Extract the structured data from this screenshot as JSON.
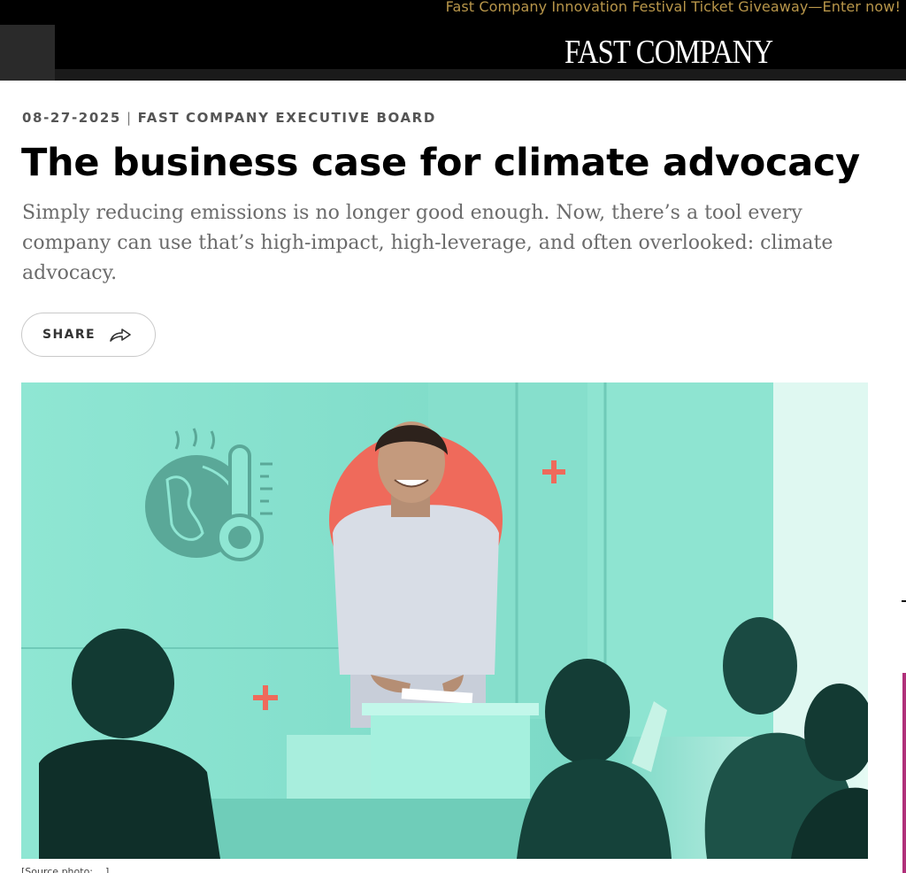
{
  "promo": {
    "text": "Fast Company Innovation Festival Ticket Giveaway—Enter now!"
  },
  "header": {
    "logo": "FAST COMPANY"
  },
  "article": {
    "date": "08-27-2025",
    "separator": "|",
    "section": "FAST COMPANY EXECUTIVE BOARD",
    "title": "The business case for climate advocacy",
    "deck": "Simply reducing emissions is no longer good enough. Now, there’s a tool every company can use that’s high-impact, high-leverage, and often overlooked: climate advocacy.",
    "share_label": "SHARE",
    "caption": "[Source photo: ...]"
  },
  "colors": {
    "accent": "#ef6a5b",
    "teal": "#7fe0cc",
    "text_muted": "#6b6b6b",
    "promo_gold": "#b8964a"
  },
  "icons": {
    "share": "share-arrow-icon",
    "globe": "globe-icon",
    "thermometer": "thermometer-icon",
    "plus": "plus-icon"
  }
}
